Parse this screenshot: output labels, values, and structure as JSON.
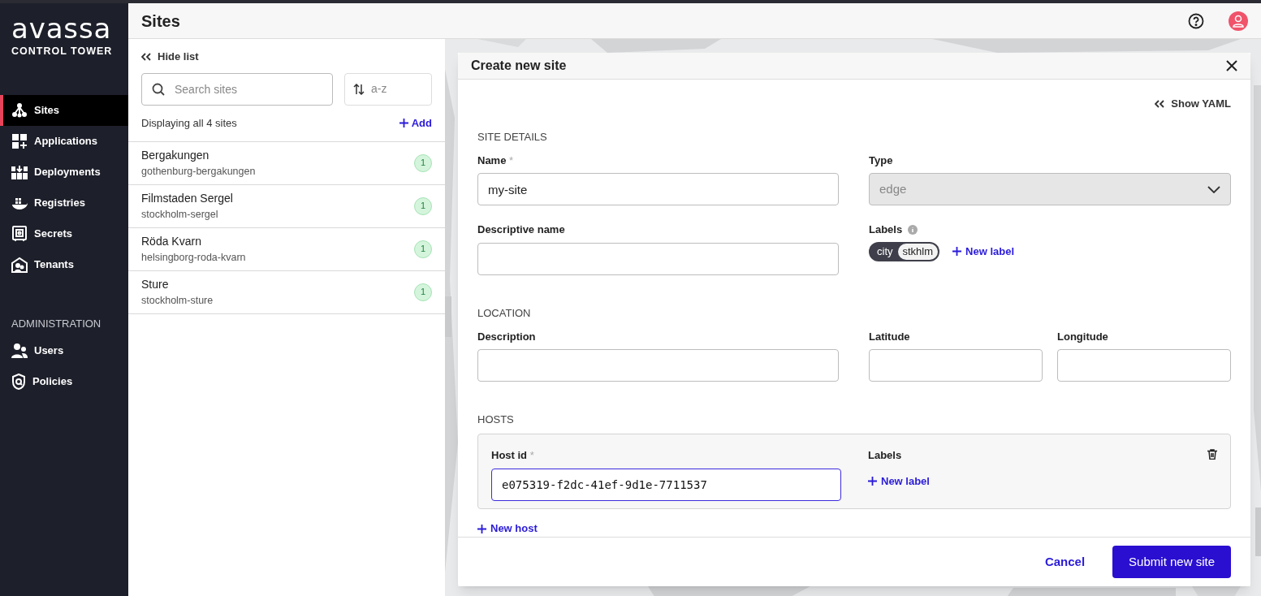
{
  "brand": {
    "logo": "avassa",
    "subtitle": "CONTROL TOWER"
  },
  "nav": [
    {
      "label": "Sites",
      "kind": "sites",
      "selected": true
    },
    {
      "label": "Applications",
      "kind": "apps",
      "selected": false
    },
    {
      "label": "Deployments",
      "kind": "deployments",
      "selected": false
    },
    {
      "label": "Registries",
      "kind": "registries",
      "selected": false
    },
    {
      "label": "Secrets",
      "kind": "secrets",
      "selected": false
    },
    {
      "label": "Tenants",
      "kind": "tenants",
      "selected": false
    }
  ],
  "admin": {
    "heading": "ADMINISTRATION",
    "items": [
      {
        "label": "Users",
        "kind": "users",
        "selected": false
      },
      {
        "label": "Policies",
        "kind": "policies",
        "selected": false
      }
    ]
  },
  "header": {
    "title": "Sites"
  },
  "list": {
    "hide": "Hide list",
    "search": {
      "placeholder": "Search sites"
    },
    "sort": "a-z",
    "count": "Displaying all 4 sites",
    "add": "Add",
    "sites": [
      {
        "name": "Bergakungen",
        "slug": "gothenburg-bergakungen",
        "badge": "1"
      },
      {
        "name": "Filmstaden Sergel",
        "slug": "stockholm-sergel",
        "badge": "1"
      },
      {
        "name": "Röda Kvarn",
        "slug": "helsingborg-roda-kvarn",
        "badge": "1"
      },
      {
        "name": "Sture",
        "slug": "stockholm-sture",
        "badge": "1"
      }
    ]
  },
  "dialog": {
    "title": "Create new site",
    "show_yaml": "Show YAML",
    "site_details": {
      "heading": "SITE DETAILS",
      "name": {
        "label": "Name",
        "mark": "*",
        "value": "my-site"
      },
      "type": {
        "label": "Type",
        "value": "edge",
        "disabled": true
      },
      "descriptive_name": {
        "label": "Descriptive name"
      },
      "labels": {
        "label": "Labels",
        "chips": [
          {
            "key": "city",
            "value": "stkhlm"
          }
        ],
        "new_label": "New label"
      }
    },
    "location": {
      "heading": "LOCATION",
      "description": {
        "label": "Description"
      },
      "latitude": {
        "label": "Latitude"
      },
      "longitude": {
        "label": "Longitude"
      }
    },
    "hosts": {
      "heading": "HOSTS",
      "items": [
        {
          "label": "Host id",
          "mark": "*",
          "value": "e075319-f2dc-41ef-9d1e-7711537",
          "focused": true,
          "labels_label": "Labels",
          "new_label": "New label"
        }
      ],
      "new_host": "New host"
    },
    "cancel": "Cancel",
    "submit": "Submit new site"
  }
}
